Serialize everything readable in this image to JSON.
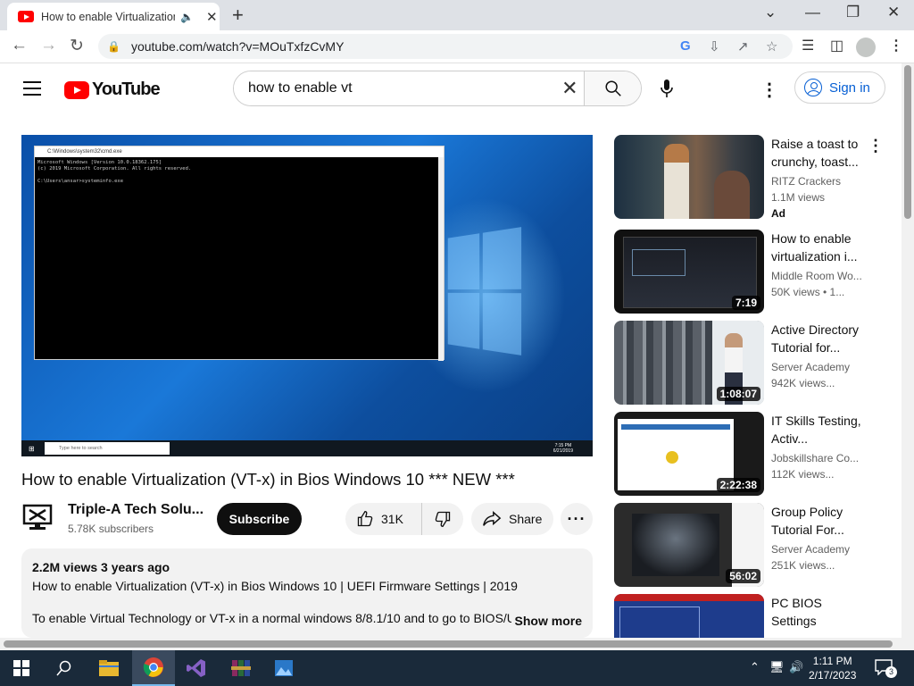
{
  "browser": {
    "tab_title": "How to enable Virtualization",
    "url": "youtube.com/watch?v=MOuTxfzCvMY"
  },
  "youtube": {
    "logo_text": "YouTube",
    "search_value": "how to enable vt",
    "signin_label": "Sign in"
  },
  "video": {
    "cmd_title": "C:\\Windows\\system32\\cmd.exe",
    "cmd_lines": "Microsoft Windows [Version 10.0.18362.175]\n(c) 2019 Microsoft Corporation. All rights reserved.\n\nC:\\Users\\ansar>systeminfo.exe",
    "taskbar_search": "Type here to search",
    "clock_time": "7:15 PM",
    "clock_date": "6/21/2019",
    "title": "How to enable Virtualization (VT-x) in Bios Windows 10 *** NEW ***",
    "channel_name": "Triple-A Tech Solu...",
    "subscribers": "5.78K subscribers",
    "subscribe_label": "Subscribe",
    "likes": "31K",
    "share_label": "Share",
    "stats": "2.2M views  3 years ago",
    "desc_line1": "How to enable Virtualization (VT-x)  in Bios Windows 10 | UEFI Firmware Settings | 2019",
    "desc_line2": "To enable Virtual Technology or VT-x in a normal windows 8/8.1/10 and to go to BIOS/UEFI Firmware Settings",
    "show_more": "Show more"
  },
  "recommendations": [
    {
      "title": "Raise a toast to crunchy, toast...",
      "channel": "RITZ Crackers",
      "views": "1.1M views",
      "ad": "Ad",
      "duration": ""
    },
    {
      "title": "How to enable virtualization i...",
      "channel": "Middle Room Wo...",
      "views": "50K views  • 1...",
      "duration": "7:19"
    },
    {
      "title": "Active Directory Tutorial for...",
      "channel": "Server Academy",
      "views": "942K views...",
      "duration": "1:08:07"
    },
    {
      "title": "IT Skills Testing, Activ...",
      "channel": "Jobskillshare Co...",
      "views": "112K views...",
      "duration": "2:22:38"
    },
    {
      "title": "Group Policy Tutorial For...",
      "channel": "Server Academy",
      "views": "251K views...",
      "duration": "56:02"
    },
    {
      "title": "PC BIOS Settings",
      "channel": "",
      "views": "",
      "duration": ""
    }
  ],
  "taskbar": {
    "time": "1:11 PM",
    "date": "2/17/2023",
    "notifications": "3"
  },
  "colors": {
    "accent_red": "#ff0000",
    "link_blue": "#065fd4",
    "taskbar_bg": "#1a2a3a"
  }
}
